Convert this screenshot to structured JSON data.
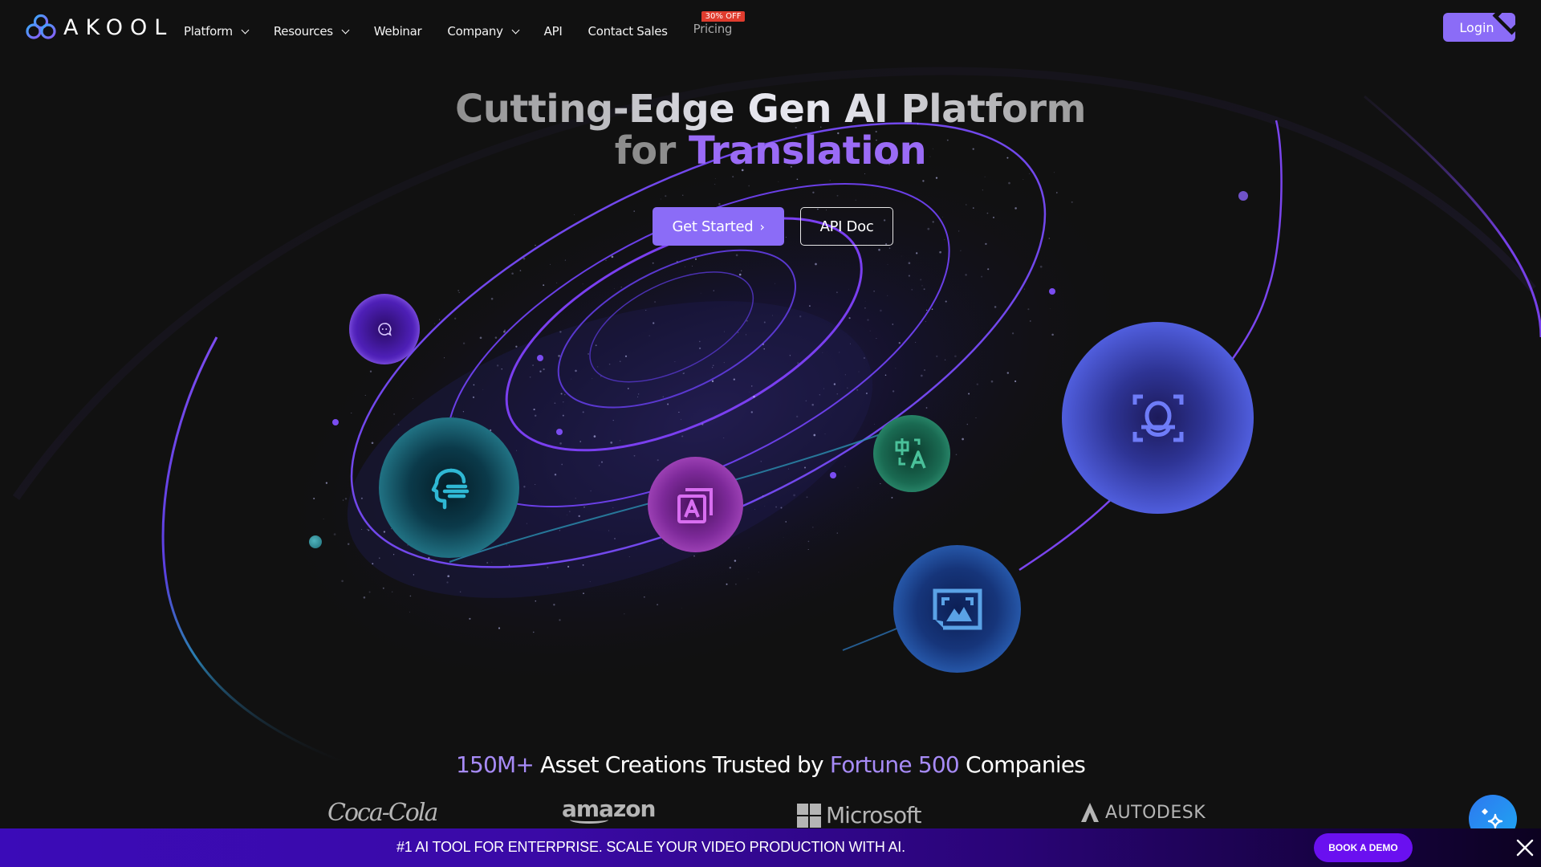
{
  "nav": {
    "brand": "AKOOL",
    "items": [
      {
        "label": "Platform",
        "dropdown": true
      },
      {
        "label": "Resources",
        "dropdown": true
      },
      {
        "label": "Webinar",
        "dropdown": false
      },
      {
        "label": "Company",
        "dropdown": true
      },
      {
        "label": "API",
        "dropdown": false
      },
      {
        "label": "Contact Sales",
        "dropdown": false
      }
    ],
    "pricing": {
      "label": "Pricing",
      "badge": "30% OFF"
    },
    "login": "Login"
  },
  "hero": {
    "line1": "Cutting-Edge Gen AI Platform",
    "line2_prefix": "for",
    "line2_accent": "Translation",
    "primary_cta": "Get Started",
    "primary_cta_arrow": "›",
    "secondary_cta": "API Doc"
  },
  "orbs": [
    {
      "name": "chat",
      "icon": "chat-bubble-icon"
    },
    {
      "name": "voice",
      "icon": "talking-head-icon"
    },
    {
      "name": "text",
      "icon": "text-layers-icon"
    },
    {
      "name": "translate",
      "icon": "translate-icon"
    },
    {
      "name": "face",
      "icon": "face-scan-icon"
    },
    {
      "name": "image",
      "icon": "image-frame-icon"
    }
  ],
  "trust": {
    "highlight1": "150M+",
    "middle": "Asset Creations Trusted by",
    "highlight2": "Fortune 500",
    "end": "Companies",
    "brands": [
      "Coca-Cola",
      "amazon",
      "Microsoft",
      "AUTODESK"
    ]
  },
  "banner": {
    "text": "#1 AI TOOL FOR ENTERPRISE. SCALE YOUR VIDEO PRODUCTION WITH AI.",
    "cta": "BOOK A DEMO"
  },
  "colors": {
    "accent": "#8b6cf7",
    "accent_text": "#9a6bf6",
    "badge": "#e03c2e",
    "background": "#111111",
    "banner_button": "#6a10f0"
  }
}
